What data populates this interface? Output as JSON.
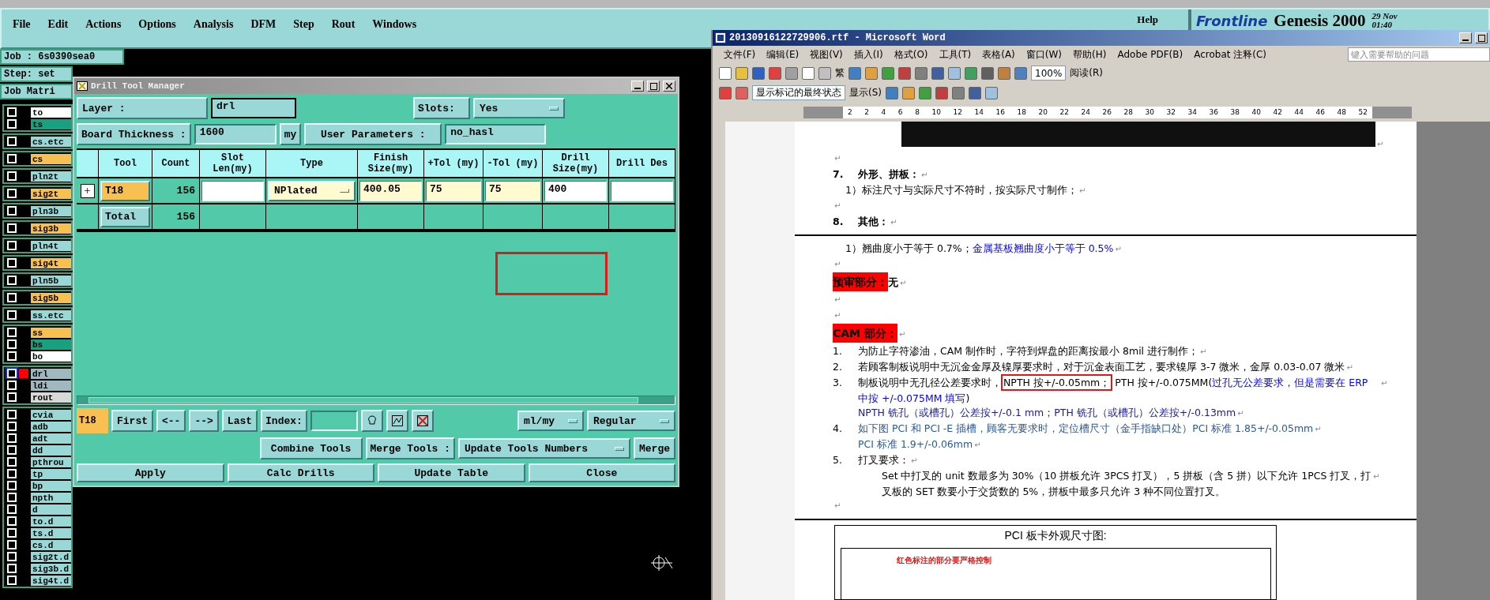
{
  "genesis": {
    "menu": [
      "File",
      "Edit",
      "Actions",
      "Options",
      "Analysis",
      "DFM",
      "Step",
      "Rout",
      "Windows"
    ],
    "help": "Help",
    "logo": "Frontline",
    "product": "Genesis 2000",
    "date": "29 Nov",
    "time": "01:40",
    "job": "Job : 6s0390sea0",
    "step": "Step: set",
    "matrix": "Job Matri",
    "layer_groups": [
      {
        "layers": [
          {
            "name": "to",
            "color": "#ffffff",
            "selected": false
          },
          {
            "name": "ts",
            "color": "#18a080",
            "selected": false
          }
        ]
      },
      {
        "layers": [
          {
            "name": "cs.etc",
            "color": "#9ad8d8",
            "selected": false
          }
        ]
      },
      {
        "layers": [
          {
            "name": "cs",
            "color": "#f8c050",
            "selected": false
          }
        ]
      },
      {
        "layers": [
          {
            "name": "pln2t",
            "color": "#9ad8d8",
            "selected": false
          }
        ]
      },
      {
        "layers": [
          {
            "name": "sig2t",
            "color": "#f8c050",
            "selected": false
          }
        ]
      },
      {
        "layers": [
          {
            "name": "pln3b",
            "color": "#9ad8d8",
            "selected": false
          }
        ]
      },
      {
        "layers": [
          {
            "name": "sig3b",
            "color": "#f8c050",
            "selected": false
          }
        ]
      },
      {
        "layers": [
          {
            "name": "pln4t",
            "color": "#9ad8d8",
            "selected": false
          }
        ]
      },
      {
        "layers": [
          {
            "name": "sig4t",
            "color": "#f8c050",
            "selected": false
          }
        ]
      },
      {
        "layers": [
          {
            "name": "pln5b",
            "color": "#9ad8d8",
            "selected": false
          }
        ]
      },
      {
        "layers": [
          {
            "name": "sig5b",
            "color": "#f8c050",
            "selected": false
          }
        ]
      },
      {
        "layers": [
          {
            "name": "ss.etc",
            "color": "#9ad8d8",
            "selected": false
          }
        ]
      },
      {
        "layers": [
          {
            "name": "ss",
            "color": "#f8c050",
            "selected": false
          },
          {
            "name": "bs",
            "color": "#18a080",
            "selected": false
          },
          {
            "name": "bo",
            "color": "#ffffff",
            "selected": false
          }
        ]
      },
      {
        "layers": [
          {
            "name": "drl",
            "color": "#a0b8c0",
            "selected": true,
            "focused": true
          },
          {
            "name": "ldi",
            "color": "#a0b8c0",
            "selected": false
          },
          {
            "name": "rout",
            "color": "#d8d8d8",
            "selected": false
          }
        ]
      },
      {
        "layers": [
          {
            "name": "cvia",
            "color": "#9ad8d8",
            "selected": false
          },
          {
            "name": "adb",
            "color": "#9ad8d8",
            "selected": false
          },
          {
            "name": "adt",
            "color": "#9ad8d8",
            "selected": false
          },
          {
            "name": "dd",
            "color": "#9ad8d8",
            "selected": false
          },
          {
            "name": "pthrou",
            "color": "#9ad8d8",
            "selected": false
          },
          {
            "name": "tp",
            "color": "#9ad8d8",
            "selected": false
          },
          {
            "name": "bp",
            "color": "#9ad8d8",
            "selected": false
          },
          {
            "name": "npth",
            "color": "#9ad8d8",
            "selected": false
          },
          {
            "name": "d",
            "color": "#9ad8d8",
            "selected": false
          },
          {
            "name": "to.d",
            "color": "#9ad8d8",
            "selected": false
          },
          {
            "name": "ts.d",
            "color": "#9ad8d8",
            "selected": false
          },
          {
            "name": "cs.d",
            "color": "#9ad8d8",
            "selected": false
          },
          {
            "name": "sig2t.d",
            "color": "#9ad8d8",
            "selected": false
          },
          {
            "name": "sig3b.d",
            "color": "#9ad8d8",
            "selected": false
          },
          {
            "name": "sig4t.d",
            "color": "#9ad8d8",
            "selected": false
          }
        ]
      }
    ]
  },
  "drill": {
    "title": "Drill Tool Manager",
    "layer_label": "Layer :",
    "layer": "drl",
    "slots_label": "Slots:",
    "slots": "Yes",
    "thickness_label": "Board Thickness :",
    "thickness": "1600",
    "thickness_unit": "my",
    "params_button": "User Parameters :",
    "params": "no_hasl",
    "columns": [
      "",
      "Tool",
      "Count",
      "Slot Len(my)",
      "Type",
      "Finish Size(my)",
      "+Tol (my)",
      "-Tol (my)",
      "Drill Size(my)",
      "Drill Des"
    ],
    "rows": [
      {
        "cells": [
          {
            "kind": "expand",
            "value": "+"
          },
          {
            "kind": "tool",
            "value": "T18",
            "color": "#f8c050"
          },
          {
            "kind": "count",
            "value": "156"
          },
          {
            "kind": "field",
            "color": "#ffffff"
          },
          {
            "kind": "dropdown",
            "value": "NPlated",
            "color": "#fffad0"
          },
          {
            "kind": "field",
            "value": "400.05",
            "color": "#fffad0"
          },
          {
            "kind": "field",
            "value": "75",
            "color": "#fffad0"
          },
          {
            "kind": "field",
            "value": "75",
            "color": "#fffad0"
          },
          {
            "kind": "field",
            "value": "400",
            "color": "#ffffff"
          },
          {
            "kind": "field",
            "color": "#ffffff"
          }
        ]
      },
      {
        "cells": [
          {
            "kind": "empty"
          },
          {
            "kind": "tool",
            "value": "Total",
            "color": "#9ad8d8"
          },
          {
            "kind": "count",
            "value": "156"
          }
        ]
      }
    ],
    "current": "T18",
    "nav": [
      "First",
      "<--",
      "-->",
      "Last"
    ],
    "index_label": "Index:",
    "units": "ml/my",
    "mode": "Regular",
    "combine": "Combine Tools",
    "merge_label": "Merge Tools :",
    "merge_mode": "Update Tools Numbers",
    "merge": "Merge",
    "actions": [
      "Apply",
      "Calc Drills",
      "Update Table",
      "Close"
    ]
  },
  "word": {
    "title": "20130916122729906.rtf - Microsoft Word",
    "menu": [
      "文件(F)",
      "编辑(E)",
      "视图(V)",
      "插入(I)",
      "格式(O)",
      "工具(T)",
      "表格(A)",
      "窗口(W)",
      "帮助(H)",
      "Adobe PDF(B)",
      "Acrobat 注释(C)"
    ],
    "help_placeholder": "键入需要帮助的问题",
    "toolbar": {
      "traditional": "繁",
      "zoom": "100%",
      "read": "阅读(R)",
      "markup": "显示标记的最终状态",
      "show": "显示(S)"
    },
    "ruler": [
      "2",
      "2",
      "4",
      "6",
      "8",
      "10",
      "12",
      "14",
      "16",
      "18",
      "20",
      "22",
      "24",
      "26",
      "28",
      "30",
      "32",
      "34",
      "36",
      "38",
      "40",
      "42",
      "44",
      "46",
      "48",
      "52"
    ],
    "pilcrow": "↵",
    "paragraphs": [
      {
        "kind": "image",
        "mark": true
      },
      {
        "kind": "blank",
        "mark": true
      },
      {
        "kind": "heading",
        "number": "7.",
        "runs": [
          {
            "text": "外形、拼板：",
            "color": "#000000"
          }
        ],
        "mark": true
      },
      {
        "kind": "indent",
        "runs": [
          {
            "text": "1）标注尺寸与实际尺寸不符时，按实际尺寸制作；",
            "color": "#000000"
          }
        ],
        "mark": true
      },
      {
        "kind": "blank",
        "mark": true
      },
      {
        "kind": "heading",
        "number": "8.",
        "runs": [
          {
            "text": "其他：",
            "color": "#000000"
          }
        ],
        "mark": true
      },
      {
        "kind": "page-break"
      },
      {
        "kind": "indent",
        "runs": [
          {
            "text": "1）翘曲度小于等于 0.7%；",
            "color": "#000000"
          },
          {
            "text": "金属基板翘曲度小于等于 0.5%",
            "color": "#0000ff"
          }
        ],
        "mark": true
      },
      {
        "kind": "blank",
        "mark": true
      },
      {
        "kind": "label",
        "runs": [
          {
            "text": "预审部分：",
            "color": "#000000"
          }
        ],
        "tail": " 无",
        "mark": true
      },
      {
        "kind": "blank",
        "mark": true
      },
      {
        "kind": "blank",
        "mark": true
      },
      {
        "kind": "label",
        "runs": [
          {
            "text": "CAM 部分：",
            "color": "#000000"
          }
        ],
        "mark": true
      },
      {
        "kind": "item",
        "number": "1.",
        "runs": [
          {
            "text": "为防止字符渗油，CAM 制作时，字符到焊盘的距离按最小 8mil 进行制作；",
            "color": "#000000"
          }
        ],
        "mark": true
      },
      {
        "kind": "item",
        "number": "2.",
        "runs": [
          {
            "text": "若顾客制板说明中无沉金金厚及镍厚要求时，对于沉金表面工艺，要求镍厚 3-7 微米，金厚 0.03-0.07 微米",
            "color": "#000000"
          }
        ],
        "mark": true
      },
      {
        "kind": "item",
        "number": "3.",
        "runs": [
          {
            "text": "制板说明中无孔径公差要求时，",
            "color": "#000000"
          },
          {
            "text": "NPTH 按+/-0.05mm；",
            "color": "#000000",
            "boxed": true
          },
          {
            "text": "PTH 按+/-0.075MM(",
            "color": "#000000"
          },
          {
            "text": "过孔无公差要求，但是需要在 ERP 中按 +/-0.075MM 填写",
            "color": "#0000ff"
          },
          {
            "text": ")",
            "color": "#000000"
          }
        ],
        "mark": true
      },
      {
        "kind": "sub",
        "runs": [
          {
            "text": "NPTH 铣孔（或槽孔）公差按+/-0.1 mm；PTH 铣孔（或槽孔）公差按+/-0.13mm",
            "color": "#1a1a9a"
          }
        ],
        "mark": true
      },
      {
        "kind": "item",
        "number": "4.",
        "runs": [
          {
            "text": "如下图 PCI 和 PCI -E 插槽，顾客无要求时，定位槽尺寸（金手指缺口处）PCI 标准 1.85+/-0.05mm",
            "color": "#2a5a9a"
          }
        ],
        "mark": true
      },
      {
        "kind": "sub",
        "runs": [
          {
            "text": "PCI 标准 1.9+/-0.06mm",
            "color": "#2a5a9a"
          }
        ],
        "mark": true
      },
      {
        "kind": "item",
        "number": "5.",
        "runs": [
          {
            "text": "打叉要求：",
            "color": "#000000"
          }
        ],
        "mark": true
      },
      {
        "kind": "para",
        "runs": [
          {
            "text": "Set 中打叉的 unit 数最多为 30%（10 拼板允许 3PCS 打叉），5 拼板（含 5 拼）以下允许 1PCS 打叉，打叉板的 SET 数要小于交货数的 5%，拼板中最多只允许 3 种不同位置打叉。",
            "color": "#000000"
          }
        ],
        "mark": true
      },
      {
        "kind": "blank",
        "mark": true
      },
      {
        "kind": "page-break"
      },
      {
        "kind": "figure",
        "title": "PCI 板卡外观尺寸图:",
        "note": "红色标注的部分要严格控制"
      }
    ]
  }
}
